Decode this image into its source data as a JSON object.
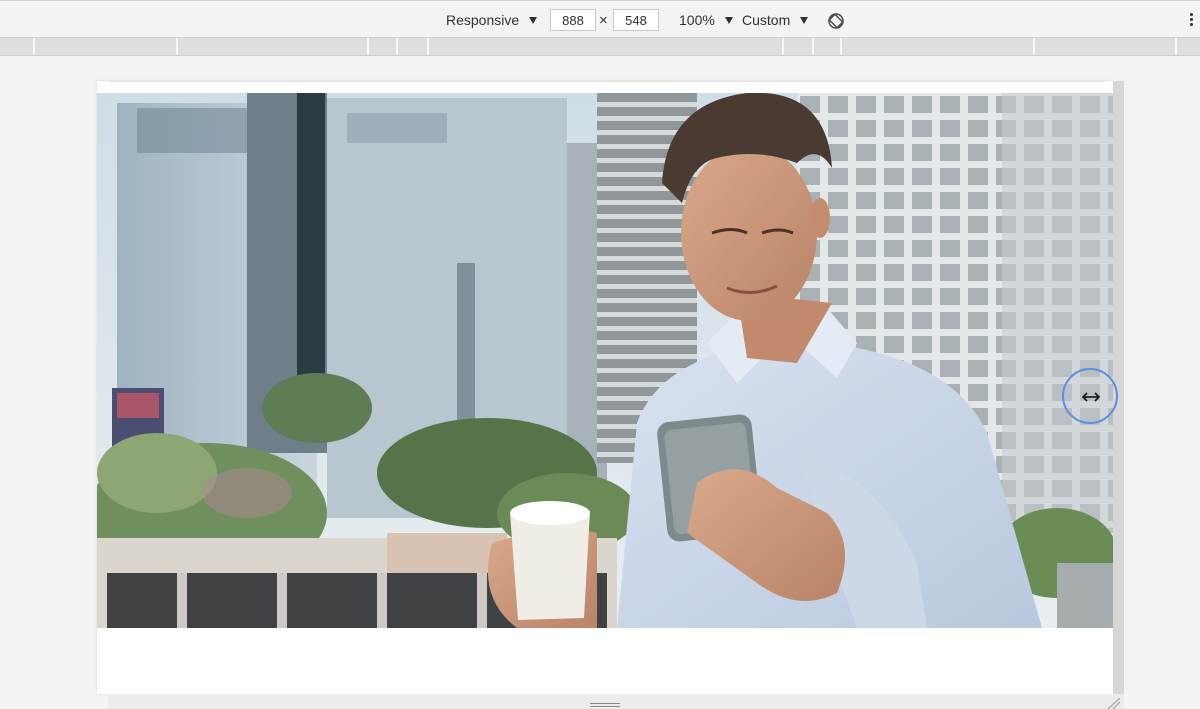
{
  "toolbar": {
    "device_label": "Responsive",
    "width_value": "888",
    "times_symbol": "×",
    "height_value": "548",
    "zoom_label": "100%",
    "throttle_label": "Custom"
  },
  "icons": {
    "rotate": "rotate-icon",
    "more": "kebab-menu-icon",
    "resize_cursor": "horizontal-resize-icon"
  },
  "colors": {
    "toolbar_bg": "#f3f3f3",
    "ruler_bg": "#dedede",
    "cursor_ring": "#5b8fe0"
  }
}
